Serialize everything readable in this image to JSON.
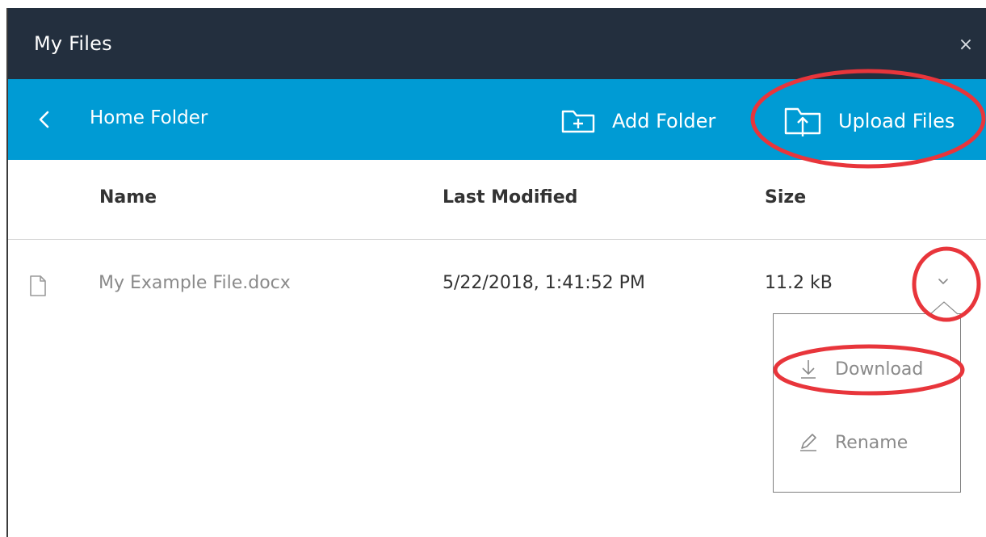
{
  "window": {
    "title": "My Files",
    "close_glyph": "×"
  },
  "nav": {
    "back_icon": "chevron-left-icon",
    "folder_title": "Home Folder",
    "add_folder_label": "Add Folder",
    "upload_files_label": "Upload Files"
  },
  "table": {
    "columns": [
      "Name",
      "Last Modified",
      "Size"
    ],
    "rows": [
      {
        "name": "My Example File.docx",
        "last_modified": "5/22/2018, 1:41:52 PM",
        "size": "11.2 kB"
      }
    ]
  },
  "row_menu": {
    "items": [
      {
        "label": "Download",
        "icon": "download-icon"
      },
      {
        "label": "Rename",
        "icon": "pencil-icon"
      }
    ]
  },
  "colors": {
    "title_bar": "#232f3e",
    "nav_bar": "#009bd4",
    "annotation_red": "#e8353b"
  }
}
